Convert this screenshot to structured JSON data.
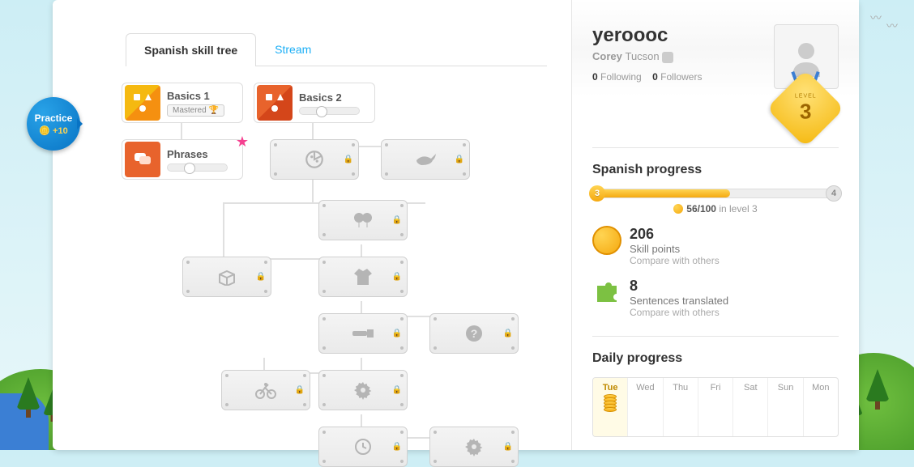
{
  "practice": {
    "label": "Practice",
    "points": "+10"
  },
  "tabs": {
    "skill_tree": "Spanish skill tree",
    "stream": "Stream"
  },
  "skills": {
    "basics1": {
      "title": "Basics 1",
      "badge": "Mastered"
    },
    "basics2": {
      "title": "Basics 2"
    },
    "phrases": {
      "title": "Phrases"
    }
  },
  "user": {
    "name": "yeroooc",
    "realname": "Corey",
    "location": "Tucson",
    "following_count": "0",
    "following_label": "Following",
    "followers_count": "0",
    "followers_label": "Followers",
    "level_label": "LEVEL",
    "level": "3"
  },
  "progress": {
    "title": "Spanish progress",
    "current_level": "3",
    "next_level": "4",
    "points_text": "56/100",
    "points_suffix": "in level 3",
    "fill_percent": 56
  },
  "stats": {
    "points": {
      "value": "206",
      "label": "Skill points",
      "compare": "Compare with others"
    },
    "sentences": {
      "value": "8",
      "label": "Sentences translated",
      "compare": "Compare with others"
    }
  },
  "daily": {
    "title": "Daily progress",
    "days": [
      "Tue",
      "Wed",
      "Thu",
      "Fri",
      "Sat",
      "Sun",
      "Mon"
    ],
    "active_day": "Tue"
  }
}
